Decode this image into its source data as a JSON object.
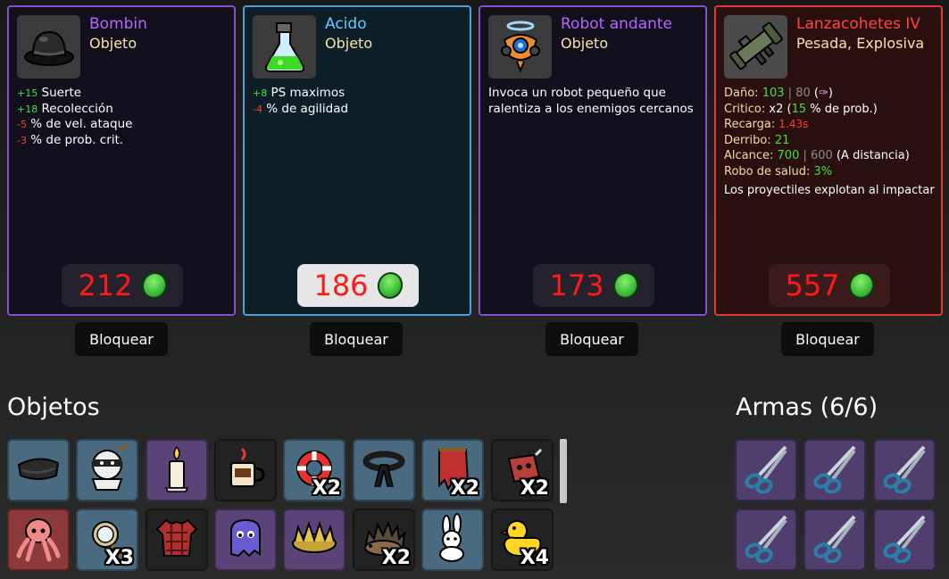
{
  "shop": {
    "cards": [
      {
        "name": "Bombin",
        "name_color": "#b566ff",
        "type": "Objeto",
        "icon": "bowler-hat-icon",
        "stats": [
          {
            "value": "+15",
            "label": "Suerte",
            "sign": "pos"
          },
          {
            "value": "+18",
            "label": "Recolección",
            "sign": "pos"
          },
          {
            "value": "-5",
            "label": "% de vel. ataque",
            "sign": "neg"
          },
          {
            "value": "-3",
            "label": "% de prob. crit.",
            "sign": "neg"
          }
        ],
        "price": "212"
      },
      {
        "name": "Acido",
        "name_color": "#6ec8ff",
        "type": "Objeto",
        "icon": "acid-flask-icon",
        "stats": [
          {
            "value": "+8",
            "label": "PS maximos",
            "sign": "pos"
          },
          {
            "value": "-4",
            "label": "% de agilidad",
            "sign": "neg"
          }
        ],
        "price": "186"
      },
      {
        "name": "Robot andante",
        "name_color": "#b566ff",
        "type": "Objeto",
        "icon": "robot-icon",
        "description": "Invoca un robot pequeño que ralentiza a los enemigos cercanos",
        "price": "173"
      },
      {
        "name": "Lanzacohetes IV",
        "name_color": "#ff4545",
        "type": "Pesada, Explosiva",
        "icon": "rocket-launcher-icon",
        "weapon_stats": {
          "damage_label": "Daño:",
          "damage": "103",
          "damage_base": "80",
          "crit_label": "Critico:",
          "crit_mult": "x2",
          "crit_chance": "15",
          "crit_suffix": "% de prob.)",
          "cooldown_label": "Recarga:",
          "cooldown": "1.43s",
          "knockback_label": "Derribo:",
          "knockback": "21",
          "range_label": "Alcance:",
          "range": "700",
          "range_base": "600",
          "range_suffix": "(A distancia)",
          "lifesteal_label": "Robo de salud:",
          "lifesteal": "3%",
          "effect": "Los proyectiles explotan al impactar"
        },
        "price": "557"
      }
    ],
    "lock_label": "Bloquear"
  },
  "inventory": {
    "items_title": "Objetos",
    "weapons_title": "Armas (6/6)",
    "items": [
      {
        "icon": "bandana-icon",
        "bg": "blue",
        "count": ""
      },
      {
        "icon": "ninja-icon",
        "bg": "blue",
        "count": ""
      },
      {
        "icon": "candle-icon",
        "bg": "purple",
        "count": ""
      },
      {
        "icon": "coffee-mug-icon",
        "bg": "dark",
        "count": ""
      },
      {
        "icon": "lifebuoy-icon",
        "bg": "blue",
        "count": "X2"
      },
      {
        "icon": "black-belt-icon",
        "bg": "blue",
        "count": ""
      },
      {
        "icon": "torn-cape-icon",
        "bg": "blue",
        "count": "X2"
      },
      {
        "icon": "meat-chunk-icon",
        "bg": "dark",
        "count": "X2"
      },
      {
        "icon": "octopus-icon",
        "bg": "red",
        "count": ""
      },
      {
        "icon": "compact-mirror-icon",
        "bg": "blue",
        "count": "X3"
      },
      {
        "icon": "plaid-shirt-icon",
        "bg": "dark",
        "count": ""
      },
      {
        "icon": "ghost-cloak-icon",
        "bg": "purple",
        "count": ""
      },
      {
        "icon": "spiked-crown-icon",
        "bg": "purple",
        "count": ""
      },
      {
        "icon": "hedgehog-icon",
        "bg": "dark",
        "count": "X2"
      },
      {
        "icon": "bunny-icon",
        "bg": "blue",
        "count": ""
      },
      {
        "icon": "rubber-duck-icon",
        "bg": "dark",
        "count": "X4"
      }
    ],
    "weapons": [
      {
        "icon": "scissors-icon"
      },
      {
        "icon": "scissors-icon"
      },
      {
        "icon": "scissors-icon"
      },
      {
        "icon": "scissors-icon"
      },
      {
        "icon": "scissors-icon"
      },
      {
        "icon": "scissors-icon"
      }
    ]
  }
}
